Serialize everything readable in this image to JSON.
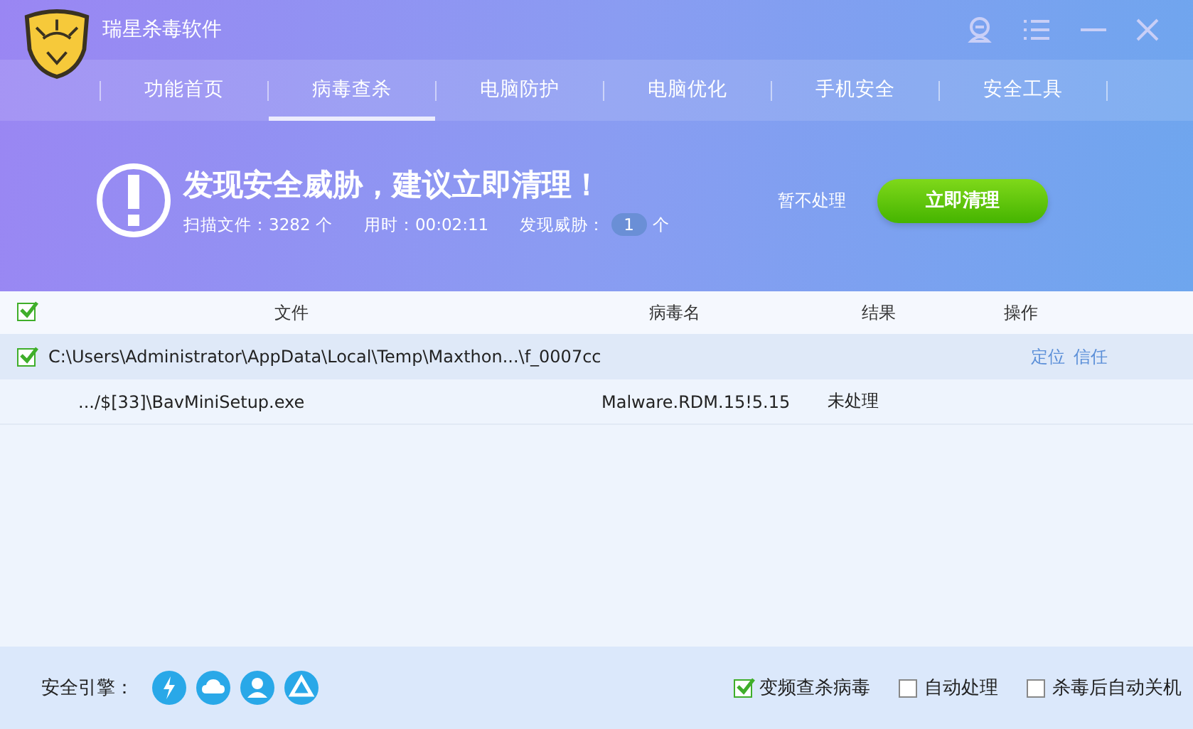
{
  "window": {
    "title": "瑞星杀毒软件"
  },
  "tabs": [
    {
      "label": "功能首页",
      "selected": false
    },
    {
      "label": "病毒查杀",
      "selected": true
    },
    {
      "label": "电脑防护",
      "selected": false
    },
    {
      "label": "电脑优化",
      "selected": false
    },
    {
      "label": "手机安全",
      "selected": false
    },
    {
      "label": "安全工具",
      "selected": false
    }
  ],
  "alert": {
    "headline": "发现安全威胁，建议立即清理！",
    "scanned_label": "扫描文件：",
    "scanned": "3282 个",
    "time_label": "用时：",
    "time": "00:02:11",
    "threats_label": "发现威胁：",
    "threats": "1",
    "threats_unit": "个",
    "ignore": "暂不处理",
    "clean": "立即清理"
  },
  "table": {
    "select_all": true,
    "columns": [
      "文件",
      "病毒名",
      "结果",
      "操作"
    ],
    "groups": [
      {
        "path": "C:\\Users\\Administrator\\AppData\\Local\\Temp\\Maxthon...\\f_0007cc",
        "checked": true,
        "actions": [
          "定位",
          "信任"
        ],
        "children": [
          {
            "file": ".../$[33]\\BavMiniSetup.exe",
            "virus": "Malware.RDM.15!5.15",
            "result": "未处理"
          }
        ]
      }
    ]
  },
  "footer": {
    "engine_label": "安全引擎：",
    "options": [
      {
        "label": "变频查杀病毒",
        "checked": true
      },
      {
        "label": "自动处理",
        "checked": false
      },
      {
        "label": "杀毒后自动关机",
        "checked": false
      }
    ]
  }
}
